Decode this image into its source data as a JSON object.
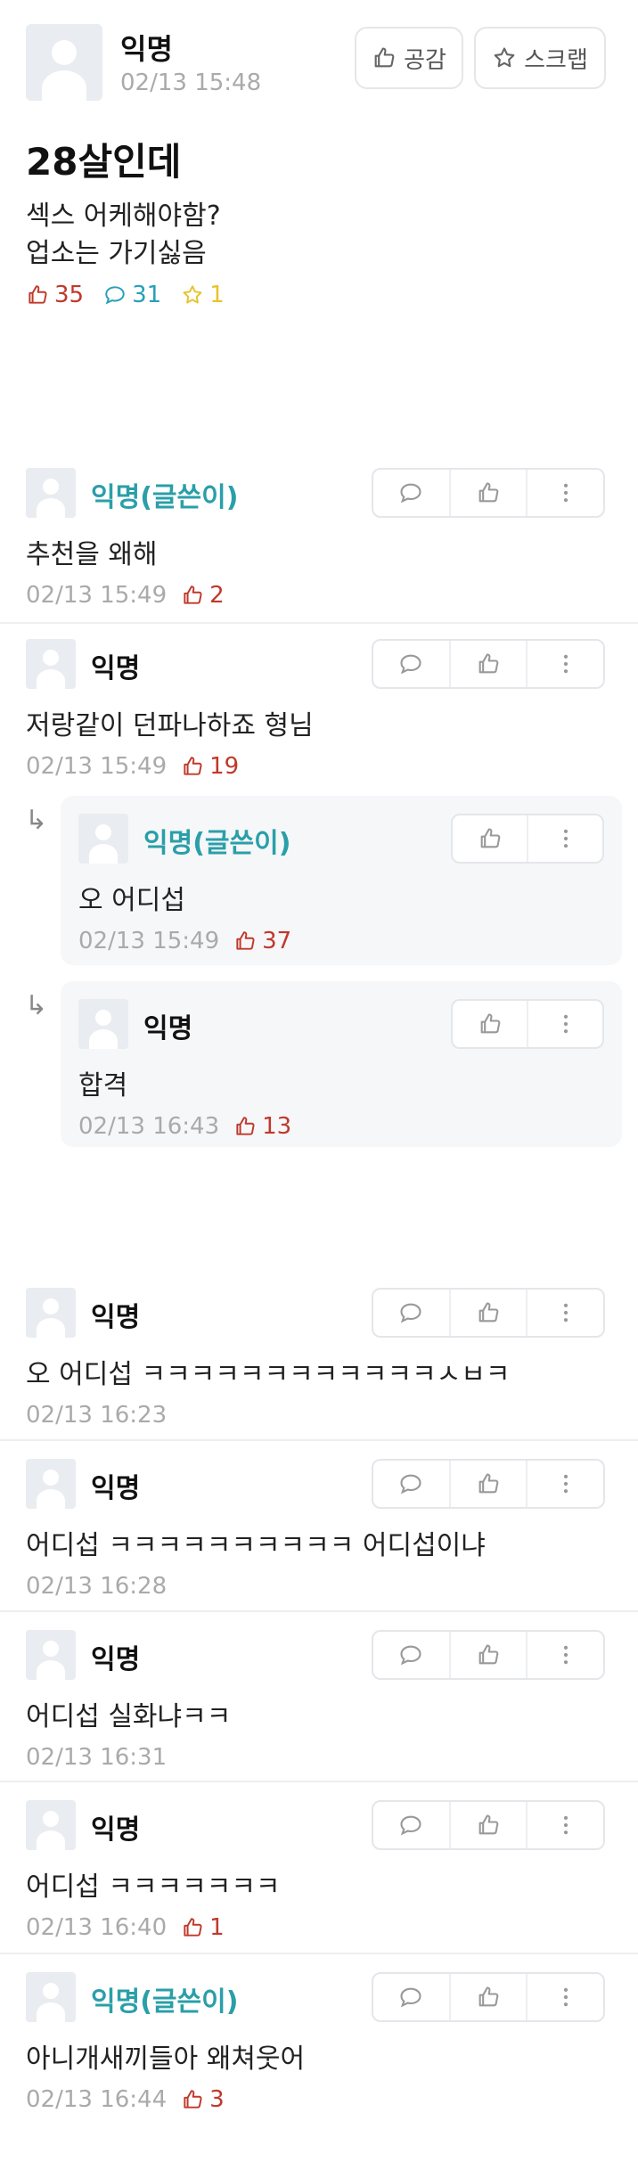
{
  "post": {
    "author": "익명",
    "time": "02/13 15:48",
    "like_button": "공감",
    "scrap_button": "스크랩",
    "title": "28살인데",
    "body_lines": [
      "섹스 어케해야함?",
      "업소는 가기싫음"
    ],
    "stats": {
      "likes": "35",
      "comments": "31",
      "scraps": "1"
    }
  },
  "comments": [
    {
      "author": "익명(글쓴이)",
      "is_op": true,
      "text": "추천을 왜해",
      "time": "02/13 15:49",
      "likes": "2"
    },
    {
      "author": "익명",
      "is_op": false,
      "text": "저랑같이 던파나하죠 형님",
      "time": "02/13 15:49",
      "likes": "19"
    },
    {
      "author": "익명(글쓴이)",
      "is_op": true,
      "text": "오 어디섭",
      "time": "02/13 15:49",
      "likes": "37"
    },
    {
      "author": "익명",
      "is_op": false,
      "text": "합격",
      "time": "02/13 16:43",
      "likes": "13"
    },
    {
      "author": "익명",
      "is_op": false,
      "text": "오 어디섭 ㅋㅋㅋㅋㅋㅋㅋㅋㅋㅋㅋㅋㅅㅂㅋ",
      "time": "02/13 16:23",
      "likes": ""
    },
    {
      "author": "익명",
      "is_op": false,
      "text": "어디섭 ㅋㅋㅋㅋㅋㅋㅋㅋㅋㅋ 어디섭이냐",
      "time": "02/13 16:28",
      "likes": ""
    },
    {
      "author": "익명",
      "is_op": false,
      "text": "어디섭 실화냐ㅋㅋ",
      "time": "02/13 16:31",
      "likes": ""
    },
    {
      "author": "익명",
      "is_op": false,
      "text": "어디섭 ㅋㅋㅋㅋㅋㅋㅋ",
      "time": "02/13 16:40",
      "likes": "1"
    },
    {
      "author": "익명(글쓴이)",
      "is_op": true,
      "text": "아니개새끼들아 왜쳐웃어",
      "time": "02/13 16:44",
      "likes": "3"
    }
  ],
  "icons": {
    "like": "thumbs-up-icon",
    "comment": "speech-bubble-icon",
    "scrap": "star-icon",
    "more": "vertical-dots-icon",
    "reply": "reply-arrow-icon"
  },
  "colors": {
    "op_name": "#2a9fa8",
    "like": "#c0392b",
    "comment": "#26a0b8",
    "scrap": "#e6c32e"
  }
}
